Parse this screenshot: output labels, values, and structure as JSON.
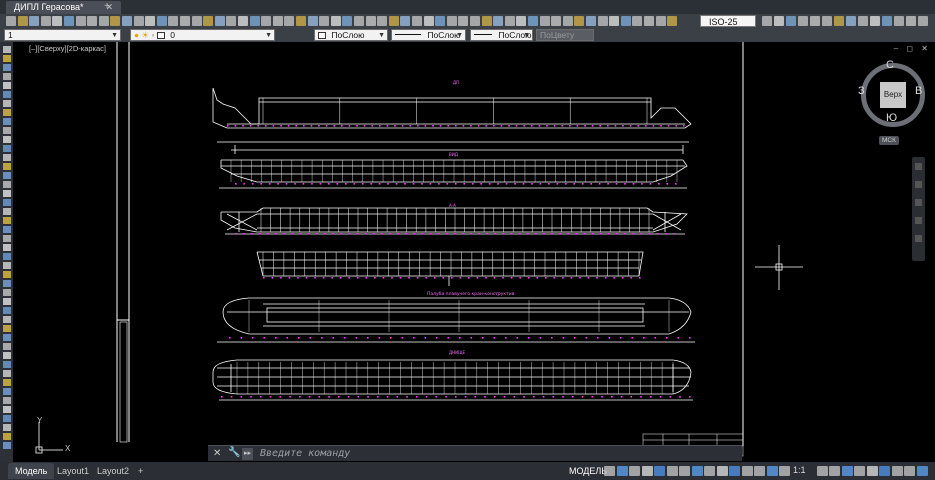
{
  "title_bar": {
    "document_tab": "ДИПЛ Герасова*",
    "close_glyph": "✕",
    "new_tab_glyph": "+"
  },
  "ribbon": {
    "dimension_style": "ISO-25"
  },
  "properties_bar": {
    "layer_state": "1",
    "current_layer": "0",
    "color": "ПоСлою",
    "linetype": "ПоСлою",
    "lineweight": "ПоСлою",
    "plot_style": "ПоЦвету"
  },
  "viewport": {
    "label": "[–][Сверху][2D-каркас]",
    "controls": "‒ ◻ ✕"
  },
  "viewcube": {
    "face": "Верх",
    "north": "С",
    "south": "Ю",
    "east": "В",
    "west": "З",
    "wcs": "МСК"
  },
  "ucs": {
    "x_label": "X",
    "y_label": "Y"
  },
  "command_line": {
    "placeholder": "Введите команду",
    "close_glyph": "✕",
    "wrench_glyph": "🔧",
    "prompt_glyph": "▸▸"
  },
  "layout_tabs": {
    "items": [
      "Модель",
      "Layout1",
      "Layout2"
    ],
    "add_glyph": "+"
  },
  "status": {
    "model": "МОДЕЛЬ",
    "annotation_scale": "1:1"
  },
  "colors": {
    "background": "#000000",
    "drawing_lines": "#ffffff",
    "dimension_markers": "#ff33ff",
    "section_labels": "#ff66ff",
    "ui_panel": "#3b3f46",
    "ucs_icon": "#cccccc",
    "crosshair": "#ffffff"
  },
  "drawing": {
    "section_caption": "Палуба плавучего кран-конструктив"
  }
}
